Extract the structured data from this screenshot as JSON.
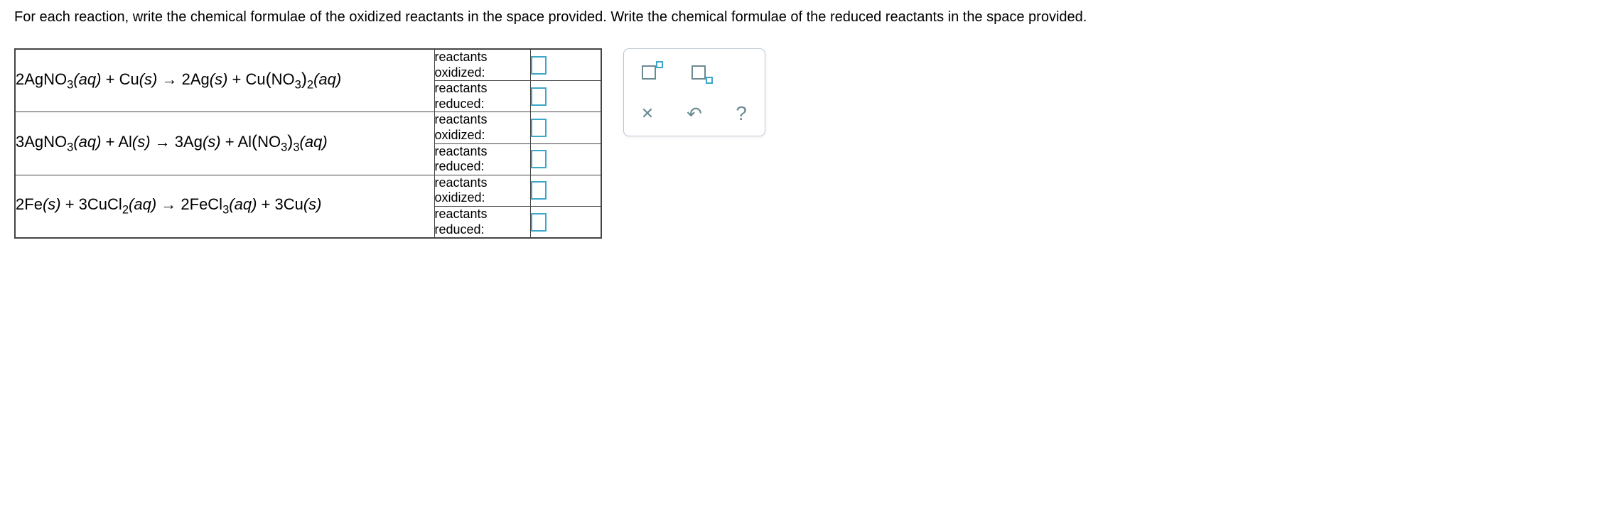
{
  "instructions": "For each reaction, write the chemical formulae of the oxidized reactants in the space provided. Write the chemical formulae of the reduced reactants in the space provided.",
  "labels": {
    "oxidized_line1": "reactants",
    "oxidized_line2": "oxidized:",
    "reduced_line1": "reactants",
    "reduced_line2": "reduced:"
  },
  "reactions": [
    {
      "lhs_coeff1": "2",
      "lhs1": "AgNO",
      "lhs1_sub": "3",
      "lhs1_state": "(aq)",
      "plus1": " + ",
      "lhs2": "Cu",
      "lhs2_state": "(s)",
      "arrow": " → ",
      "rhs_coeff1": "2",
      "rhs1": "Ag",
      "rhs1_state": "(s)",
      "plus2": " + ",
      "rhs2": "Cu",
      "rhs2_paren_open": "(",
      "rhs2_inner": "NO",
      "rhs2_inner_sub": "3",
      "rhs2_paren_close": ")",
      "rhs2_outer_sub": "2",
      "rhs2_state": "(aq)"
    },
    {
      "lhs_coeff1": "3",
      "lhs1": "AgNO",
      "lhs1_sub": "3",
      "lhs1_state": "(aq)",
      "plus1": " + ",
      "lhs2": "Al",
      "lhs2_state": "(s)",
      "arrow": " → ",
      "rhs_coeff1": "3",
      "rhs1": "Ag",
      "rhs1_state": "(s)",
      "plus2": " + ",
      "rhs2": "Al",
      "rhs2_paren_open": "(",
      "rhs2_inner": "NO",
      "rhs2_inner_sub": "3",
      "rhs2_paren_close": ")",
      "rhs2_outer_sub": "3",
      "rhs2_state": "(aq)"
    },
    {
      "lhs_coeff1": "2",
      "lhs1": "Fe",
      "lhs1_state": "(s)",
      "plus1": " + ",
      "lhs_coeff2": "3",
      "lhs2": "CuCl",
      "lhs2_sub": "2",
      "lhs2_state": "(aq)",
      "arrow": " → ",
      "rhs_coeff1": "2",
      "rhs1": "FeCl",
      "rhs1_sub": "3",
      "rhs1_state": "(aq)",
      "plus2": " + ",
      "rhs_coeff2": "3",
      "rhs2": "Cu",
      "rhs2_state": "(s)"
    }
  ]
}
